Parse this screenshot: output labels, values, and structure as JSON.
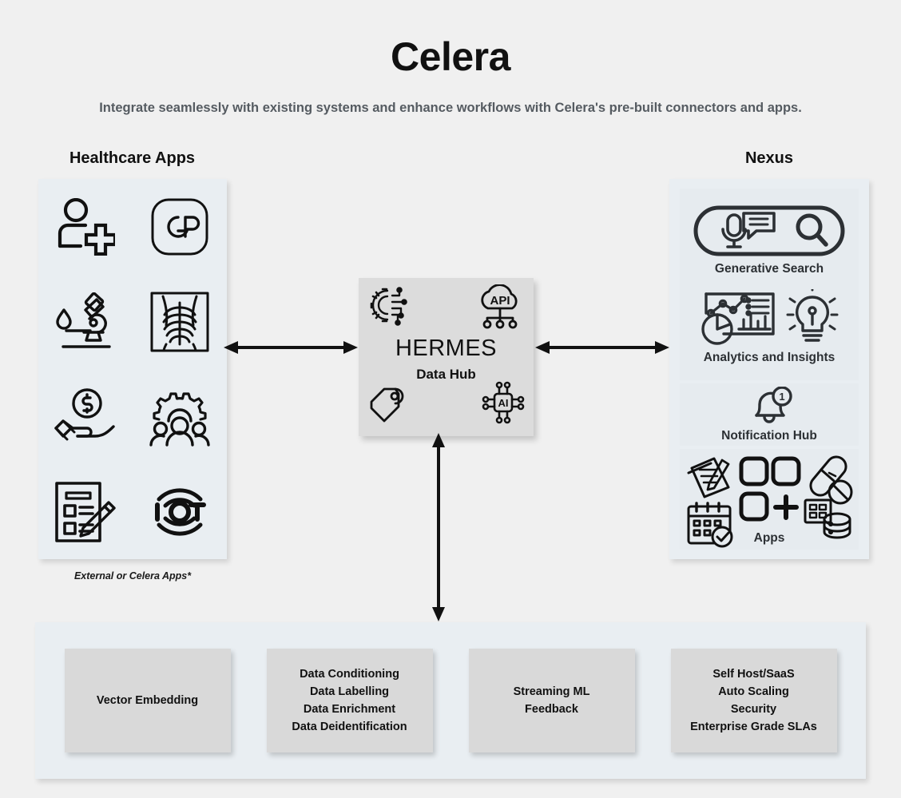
{
  "header": {
    "title": "Celera",
    "subtitle": "Integrate seamlessly with existing systems and enhance workflows with Celera's pre-built connectors and apps."
  },
  "healthcare": {
    "heading": "Healthcare Apps",
    "caption": "External or Celera Apps*",
    "icons": [
      {
        "name": "patient-add-icon",
        "label": "Patient Add"
      },
      {
        "name": "gp-badge-icon",
        "label": "GP"
      },
      {
        "name": "microscope-lab-icon",
        "label": "Laboratory"
      },
      {
        "name": "xray-imaging-icon",
        "label": "Radiology Imaging"
      },
      {
        "name": "billing-hand-coin-icon",
        "label": "Billing"
      },
      {
        "name": "population-health-gear-people-icon",
        "label": "Population Health"
      },
      {
        "name": "clipboard-form-pencil-icon",
        "label": "Forms"
      },
      {
        "name": "iot-icon",
        "label": "IoT"
      }
    ]
  },
  "hub": {
    "title": "HERMES",
    "subtitle": "Data Hub",
    "icons": [
      {
        "name": "integration-gear-circuit-icon",
        "label": "Integration"
      },
      {
        "name": "api-cloud-icon",
        "label": "API"
      },
      {
        "name": "tag-label-icon",
        "label": "Tagging"
      },
      {
        "name": "ai-chip-icon",
        "label": "AI"
      }
    ]
  },
  "nexus": {
    "heading": "Nexus",
    "cards": [
      {
        "name": "generative-search",
        "label": "Generative Search",
        "icons": [
          "mic-speech-search-bar-icon"
        ]
      },
      {
        "name": "analytics-and-insights",
        "label": "Analytics and Insights",
        "icons": [
          "analytics-dashboard-icon",
          "lightbulb-insight-icon"
        ]
      },
      {
        "name": "notification-hub",
        "label": "Notification Hub",
        "badge": "1",
        "icons": [
          "bell-notification-icon"
        ]
      },
      {
        "name": "apps",
        "label": "Apps",
        "icons": [
          "notes-pencil-icon",
          "app-grid-plus-icon",
          "pills-medication-icon",
          "calendar-check-icon",
          "database-icon"
        ]
      }
    ]
  },
  "platform": {
    "boxes": [
      {
        "name": "vector-embedding",
        "lines": [
          "Vector Embedding"
        ]
      },
      {
        "name": "data-processing",
        "lines": [
          "Data Conditioning",
          "Data Labelling",
          "Data Enrichment",
          "Data Deidentification"
        ]
      },
      {
        "name": "streaming-ml",
        "lines": [
          "Streaming ML",
          "Feedback"
        ]
      },
      {
        "name": "deployment-security",
        "lines": [
          "Self Host/SaaS",
          "Auto Scaling",
          "Security",
          "Enterprise Grade SLAs"
        ]
      }
    ]
  },
  "arrows": [
    {
      "name": "arrow-healthcare-to-hub",
      "direction": "bidirectional-horizontal"
    },
    {
      "name": "arrow-hub-to-nexus",
      "direction": "bidirectional-horizontal"
    },
    {
      "name": "arrow-hub-to-platform",
      "direction": "bidirectional-vertical"
    }
  ],
  "colors": {
    "background": "#f0f0f0",
    "panel": "#e9eef2",
    "hub": "#dcdcdc",
    "box": "#d9d9d9",
    "text": "#111111",
    "subtitle_text": "#555b61"
  }
}
